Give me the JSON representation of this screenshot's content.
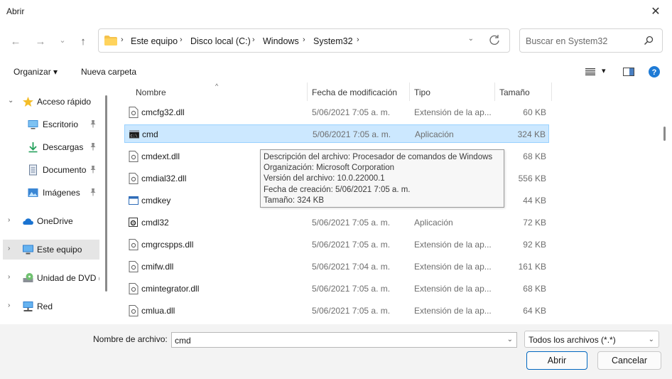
{
  "window": {
    "title": "Abrir",
    "close_glyph": "✕"
  },
  "nav": {
    "back_glyph": "←",
    "forward_glyph": "→",
    "recent_glyph": "⌄",
    "up_glyph": "↑"
  },
  "address": {
    "crumbs": [
      "Este equipo",
      "Disco local (C:)",
      "Windows",
      "System32"
    ],
    "separator": "›",
    "dropdown_glyph": "⌄"
  },
  "search": {
    "placeholder": "Buscar en System32"
  },
  "toolbar": {
    "organize_label": "Organizar ▾",
    "new_folder_label": "Nueva carpeta",
    "view_dropdown": "▾"
  },
  "sidebar": {
    "items": [
      {
        "label": "Acceso rápido",
        "chevron": "⌄",
        "icon": "star-icon"
      },
      {
        "label": "Escritorio",
        "icon": "desktop-icon",
        "pinned": true
      },
      {
        "label": "Descargas",
        "icon": "download-icon",
        "pinned": true
      },
      {
        "label": "Documentos",
        "icon": "document-icon",
        "pinned": true
      },
      {
        "label": "Imágenes",
        "icon": "image-icon",
        "pinned": true
      },
      {
        "label": "OneDrive",
        "chevron": "›",
        "icon": "cloud-icon"
      },
      {
        "label": "Este equipo",
        "chevron": "›",
        "icon": "computer-icon",
        "selected": true
      },
      {
        "label": "Unidad de DVD (",
        "chevron": "›",
        "icon": "dvd-icon"
      },
      {
        "label": "Red",
        "chevron": "›",
        "icon": "network-icon"
      }
    ]
  },
  "columns": {
    "name": "Nombre",
    "modified": "Fecha de modificación",
    "type": "Tipo",
    "size": "Tamaño",
    "sort_glyph": "^"
  },
  "files": [
    {
      "name": "cmcfg32.dll",
      "date": "5/06/2021 7:05 a. m.",
      "type": "Extensión de la ap...",
      "size": "60 KB",
      "icon": "dll-icon"
    },
    {
      "name": "cmd",
      "date": "5/06/2021 7:05 a. m.",
      "type": "Aplicación",
      "size": "324 KB",
      "icon": "console-icon",
      "selected": true
    },
    {
      "name": "cmdext.dll",
      "date": "",
      "type": "",
      "size": "68 KB",
      "icon": "dll-icon"
    },
    {
      "name": "cmdial32.dll",
      "date": "",
      "type": "",
      "size": "556 KB",
      "icon": "dll-icon"
    },
    {
      "name": "cmdkey",
      "date": "",
      "type": "",
      "size": "44 KB",
      "icon": "app-window-icon"
    },
    {
      "name": "cmdl32",
      "date": "5/06/2021 7:05 a. m.",
      "type": "Aplicación",
      "size": "72 KB",
      "icon": "app-gear-icon"
    },
    {
      "name": "cmgrcspps.dll",
      "date": "5/06/2021 7:05 a. m.",
      "type": "Extensión de la ap...",
      "size": "92 KB",
      "icon": "dll-icon"
    },
    {
      "name": "cmifw.dll",
      "date": "5/06/2021 7:04 a. m.",
      "type": "Extensión de la ap...",
      "size": "161 KB",
      "icon": "dll-icon"
    },
    {
      "name": "cmintegrator.dll",
      "date": "5/06/2021 7:05 a. m.",
      "type": "Extensión de la ap...",
      "size": "68 KB",
      "icon": "dll-icon"
    },
    {
      "name": "cmlua.dll",
      "date": "5/06/2021 7:05 a. m.",
      "type": "Extensión de la ap...",
      "size": "64 KB",
      "icon": "dll-icon"
    }
  ],
  "tooltip": {
    "lines": [
      "Descripción del archivo: Procesador de comandos de Windows",
      "Organización: Microsoft Corporation",
      "Versión del archivo: 10.0.22000.1",
      "Fecha de creación: 5/06/2021 7:05 a. m.",
      "Tamaño: 324 KB"
    ]
  },
  "footer": {
    "filename_label": "Nombre de archivo:",
    "filename_value": "cmd",
    "filter_value": "Todos los archivos (*.*)",
    "open_label": "Abrir",
    "cancel_label": "Cancelar",
    "dropdown_glyph": "⌄"
  },
  "colors": {
    "accent": "#0067c0",
    "selection_bg": "#cce8ff",
    "selection_border": "#99d1ff",
    "folder": "#f5c24c"
  }
}
